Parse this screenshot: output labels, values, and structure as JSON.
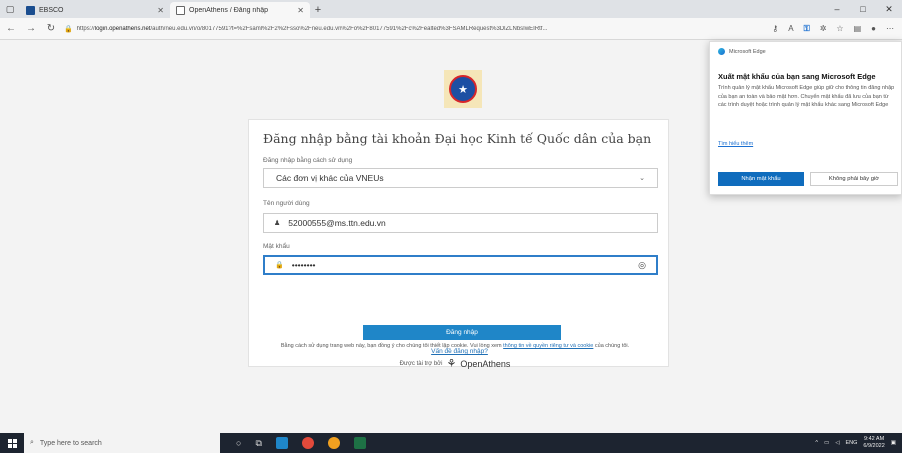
{
  "browser": {
    "tabs": [
      {
        "title": "EBSCO",
        "active": false
      },
      {
        "title": "OpenAthens / Đăng nhập",
        "active": true
      }
    ],
    "new_tab": "+",
    "url_prefix": "https://",
    "url_host": "login.openathens.net",
    "url_path": "/auth/neu.edu.vn/o/80177591?t=%2Fsaml%2F2%2Fsso%2Fneu.edu.vn%2Fo%2F80177591%2Fc%2Fealted%3FSAMLRequest%3DlZLNbsIwEIRtf...",
    "win_minimize": "–",
    "win_maximize": "□",
    "win_close": "✕"
  },
  "login": {
    "title": "Đăng nhập bằng tài khoản Đại học Kinh tế Quốc dân của bạn",
    "method_label": "Đăng nhập bằng cách sử dụng",
    "method_value": "Các đơn vị khác của VNEUs",
    "username_label": "Tên người dùng",
    "username_value": "52000555@ms.ttn.edu.vn",
    "password_label": "Mật khẩu",
    "password_value": "••••••••",
    "submit_label": "Đăng nhập",
    "forgot_label": "Vấn đề đăng nhập?"
  },
  "footer": {
    "consent_prefix": "Bằng cách sử dụng trang web này, bạn đồng ý cho chúng tôi thiết lập cookie. Vui lòng xem",
    "consent_link": "thông tin về quyền riêng tư và cookie",
    "consent_suffix": "của chúng tôi.",
    "sponsor_text": "Được tài trợ bởi",
    "sponsor_brand": "OpenAthens"
  },
  "edge_popup": {
    "app_name": "Microsoft Edge",
    "title": "Xuất mật khẩu của bạn sang Microsoft Edge",
    "body": "Trình quản lý mật khẩu Microsoft Edge giúp giữ cho thông tin đăng nhập của bạn an toàn và bảo mật hơn. Chuyển mật khẩu đã lưu của bạn từ các trình duyệt hoặc trình quản lý mật khẩu khác sang Microsoft Edge",
    "learn_more": "Tìm hiểu thêm",
    "primary_button": "Nhận mật khẩu",
    "secondary_button": "Không phải bây giờ"
  },
  "taskbar": {
    "search_placeholder": "Type here to search",
    "language": "ENG",
    "time": "9:42 AM",
    "date": "6/9/2022"
  },
  "colors": {
    "primary_button": "#1f86c8",
    "focus_border": "#2f7ec9",
    "link": "#1f6fb5",
    "edge_button": "#0f6cbd",
    "taskbar": "#1d2430"
  }
}
